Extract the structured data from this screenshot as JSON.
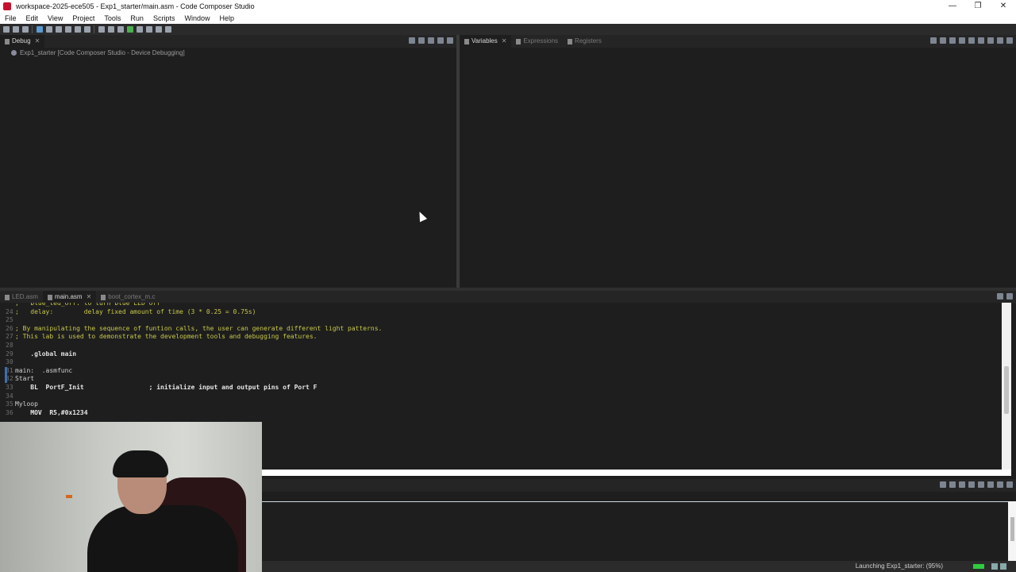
{
  "window": {
    "title": "workspace-2025-ece505 - Exp1_starter/main.asm - Code Composer Studio",
    "minimize": "—",
    "maximize": "❐",
    "close": "✕"
  },
  "menu": [
    "File",
    "Edit",
    "View",
    "Project",
    "Tools",
    "Run",
    "Scripts",
    "Window",
    "Help"
  ],
  "debug_view": {
    "tab_label": "Debug",
    "tree_item": "Exp1_starter [Code Composer Studio - Device Debugging]"
  },
  "variables_view": {
    "tabs": [
      "Variables",
      "Expressions",
      "Registers"
    ]
  },
  "editor": {
    "tabs": [
      "LED.asm",
      "main.asm",
      "boot_cortex_m.c"
    ],
    "active_tab": "main.asm",
    "lines": [
      {
        "n": "",
        "text": ";   blue_led_off: to turn blue LED off"
      },
      {
        "n": "24",
        "text": ";   delay:        delay fixed amount of time (3 * 0.25 = 0.75s)"
      },
      {
        "n": "25",
        "text": ""
      },
      {
        "n": "26",
        "text": "; By manipulating the sequence of funtion calls, the user can generate different light patterns."
      },
      {
        "n": "27",
        "text": "; This lab is used to demonstrate the development tools and debugging features."
      },
      {
        "n": "28",
        "text": ""
      },
      {
        "n": "29",
        "text": "    .global main"
      },
      {
        "n": "30",
        "text": ""
      },
      {
        "n": "31",
        "text": "main:  .asmfunc"
      },
      {
        "n": "32",
        "text": "Start"
      },
      {
        "n": "33",
        "text": "    BL  PortF_Init                 ; initialize input and output pins of Port F"
      },
      {
        "n": "34",
        "text": ""
      },
      {
        "n": "35",
        "text": "Myloop"
      },
      {
        "n": "36",
        "text": "    MOV  R5,#0x1234"
      }
    ]
  },
  "status": {
    "text": "Launching Exp1_starter: (95%)",
    "progress": 0.95
  },
  "colors": {
    "background": "#1e1e1e",
    "comment": "#c8c84a",
    "accent": "#3c6fb0",
    "progress": "#2ecc40"
  }
}
